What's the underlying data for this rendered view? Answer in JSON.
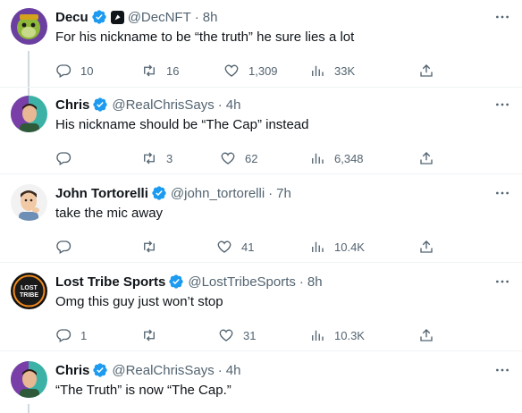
{
  "tweets": [
    {
      "name": "Decu",
      "handle": "@DecNFT",
      "time": "8h",
      "text": "For his nickname to be “the truth” he sure lies a lot",
      "replies": "10",
      "retweets": "16",
      "likes": "1,309",
      "views": "33K",
      "avatar": "green-ape-avatar"
    },
    {
      "name": "Chris",
      "handle": "@RealChrisSays",
      "time": "4h",
      "text": "His nickname should be “The Cap” instead",
      "replies": "",
      "retweets": "3",
      "likes": "62",
      "views": "6,348",
      "avatar": "man-portrait-avatar"
    },
    {
      "name": "John Tortorelli",
      "handle": "@john_tortorelli",
      "time": "7h",
      "text": "take the mic away",
      "replies": "",
      "retweets": "",
      "likes": "41",
      "views": "10.4K",
      "avatar": "cartoon-man-avatar"
    },
    {
      "name": "Lost Tribe Sports",
      "handle": "@LostTribeSports",
      "time": "8h",
      "text": "Omg this guy just won’t stop",
      "replies": "1",
      "retweets": "",
      "likes": "31",
      "views": "10.3K",
      "avatar": "lost-tribe-logo",
      "logo_text": "LOST TRIBE"
    },
    {
      "name": "Chris",
      "handle": "@RealChrisSays",
      "time": "4h",
      "text": "“The Truth” is now “The Cap.”",
      "replies": "",
      "retweets": "",
      "likes": "",
      "views": "",
      "avatar": "man-portrait-avatar"
    }
  ],
  "colors": {
    "verified_blue": "#1d9bf0",
    "muted_text": "#536471",
    "divider": "#eff3f4",
    "thread_line": "#cfd9de"
  }
}
